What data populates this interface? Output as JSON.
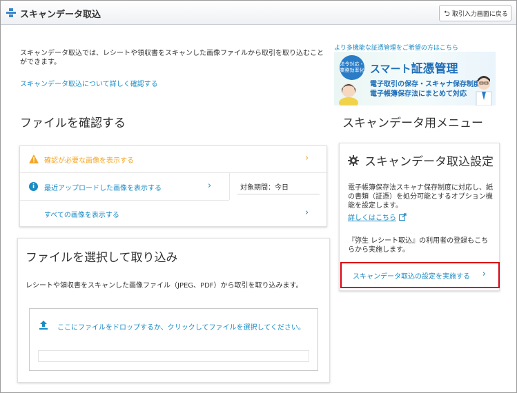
{
  "header": {
    "title": "スキャンデータ取込",
    "back_button": "取引入力画面に戻る"
  },
  "intro": {
    "description": "スキャンデータ取込では、レシートや領収書をスキャンした画像ファイルから取引を取り込むことができます。",
    "link": "スキャンデータ取込について詳しく確認する"
  },
  "promo": {
    "top_link": "より多機能な証憑管理をご希望の方はこちら",
    "badge": "法令対応・業務効率化",
    "title_pre": "スマート",
    "title_main": "証憑管理",
    "sub1": "電子取引の保存・スキャナ保存制度",
    "sub2": "電子帳簿保存法にまとめて対応"
  },
  "confirm": {
    "title": "ファイルを確認する",
    "rows": [
      {
        "label": "確認が必要な画像を表示する",
        "icon": "warning-icon"
      },
      {
        "label": "最近アップロードした画像を表示する",
        "icon": "info-icon"
      },
      {
        "label": "すべての画像を表示する",
        "icon": ""
      }
    ],
    "period": "対象期間：今日"
  },
  "import": {
    "title": "ファイルを選択して取り込み",
    "description": "レシートや領収書をスキャンした画像ファイル（JPEG、PDF）から取引を取り込みます。",
    "drop_text": "ここにファイルをドロップするか、クリックしてファイルを選択してください。"
  },
  "menu": {
    "title": "スキャンデータ用メニュー",
    "settings_title": "スキャンデータ取込設定",
    "settings_desc": "電子帳簿保存法スキャナ保存制度に対応し、紙の書類（証憑）を処分可能とするオプション機能を設定します。",
    "settings_link": "詳しくはこちら",
    "settings_note": "『弥生 レシート取込』の利用者の登録もこちらから実施します。",
    "run_button": "スキャンデータ取込の設定を実施する"
  },
  "colors": {
    "link": "#1a8bc4",
    "warning": "#f5a623",
    "highlight_border": "#d9000d"
  }
}
